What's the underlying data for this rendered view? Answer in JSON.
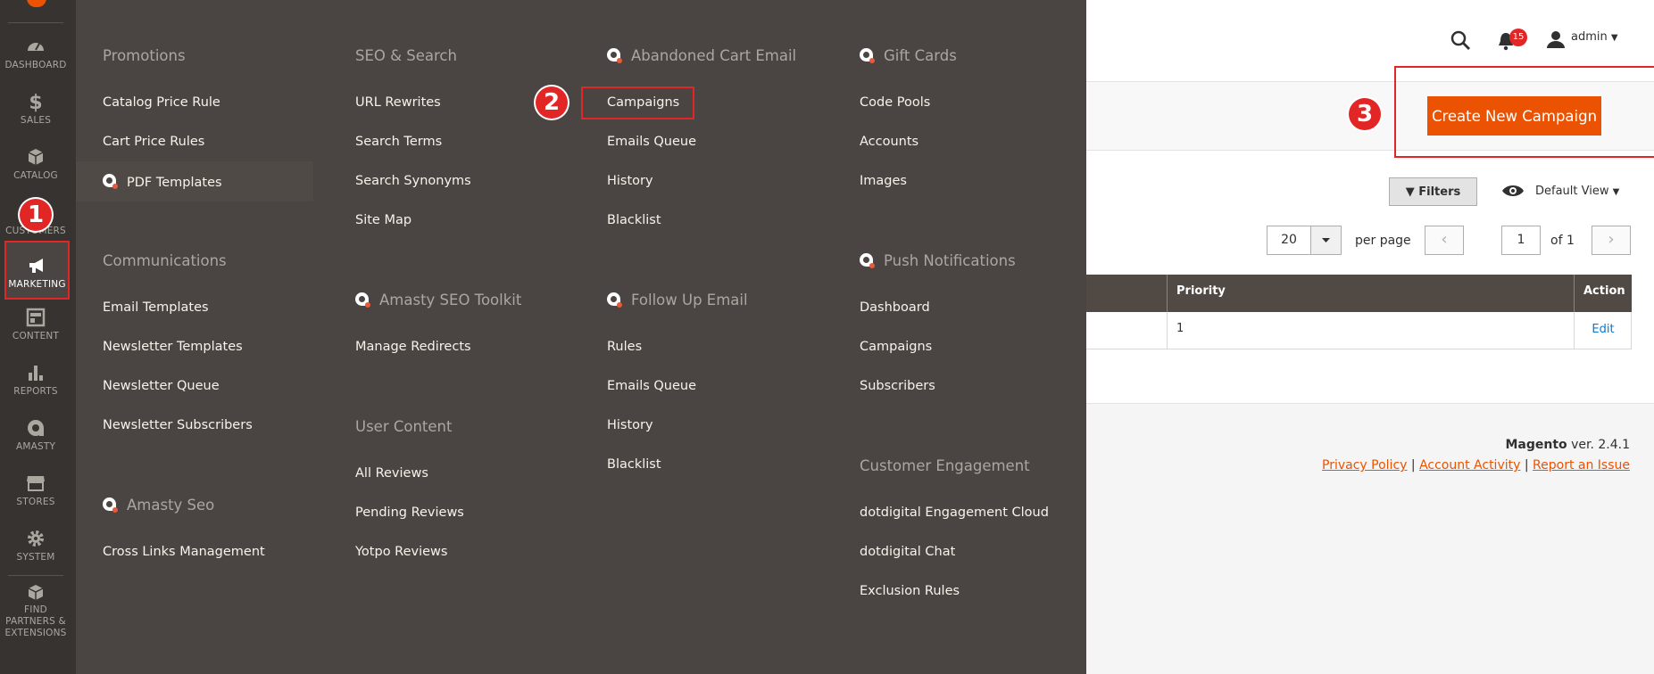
{
  "colors": {
    "sidebar": "#373330",
    "menu": "#4a4542",
    "accent": "#eb5202",
    "callout": "#e22626"
  },
  "sidebar": {
    "items": [
      {
        "label": "DASHBOARD",
        "icon": "dashboard-icon"
      },
      {
        "label": "SALES",
        "icon": "dollar-icon"
      },
      {
        "label": "CATALOG",
        "icon": "box-icon"
      },
      {
        "label": "CUSTOMERS",
        "icon": "person-icon"
      },
      {
        "label": "MARKETING",
        "icon": "megaphone-icon"
      },
      {
        "label": "CONTENT",
        "icon": "layout-icon"
      },
      {
        "label": "REPORTS",
        "icon": "bar-chart-icon"
      },
      {
        "label": "AMASTY",
        "icon": "amasty-icon"
      },
      {
        "label": "STORES",
        "icon": "store-icon"
      },
      {
        "label": "SYSTEM",
        "icon": "gear-icon"
      },
      {
        "label": "FIND PARTNERS & EXTENSIONS",
        "icon": "cubes-icon"
      }
    ]
  },
  "callouts": {
    "one": "1",
    "two": "2",
    "three": "3"
  },
  "menu": {
    "promotions": {
      "title": "Promotions",
      "items": [
        "Catalog Price Rule",
        "Cart Price Rules",
        "PDF Templates"
      ]
    },
    "communications": {
      "title": "Communications",
      "items": [
        "Email Templates",
        "Newsletter Templates",
        "Newsletter Queue",
        "Newsletter Subscribers"
      ]
    },
    "amasty_seo": {
      "title": "Amasty Seo",
      "items": [
        "Cross Links Management"
      ]
    },
    "seo_search": {
      "title": "SEO & Search",
      "items": [
        "URL Rewrites",
        "Search Terms",
        "Search Synonyms",
        "Site Map"
      ]
    },
    "amasty_seo_toolkit": {
      "title": "Amasty SEO Toolkit",
      "items": [
        "Manage Redirects"
      ]
    },
    "user_content": {
      "title": "User Content",
      "items": [
        "All Reviews",
        "Pending Reviews",
        "Yotpo Reviews"
      ]
    },
    "abandoned_cart": {
      "title": "Abandoned Cart Email",
      "items": [
        "Campaigns",
        "Emails Queue",
        "History",
        "Blacklist"
      ]
    },
    "follow_up": {
      "title": "Follow Up Email",
      "items": [
        "Rules",
        "Emails Queue",
        "History",
        "Blacklist"
      ]
    },
    "gift_cards": {
      "title": "Gift Cards",
      "items": [
        "Code Pools",
        "Accounts",
        "Images"
      ]
    },
    "push_notifications": {
      "title": "Push Notifications",
      "items": [
        "Dashboard",
        "Campaigns",
        "Subscribers"
      ]
    },
    "customer_engagement": {
      "title": "Customer Engagement",
      "items": [
        "dotdigital Engagement Cloud",
        "dotdigital Chat",
        "Exclusion Rules"
      ]
    }
  },
  "header": {
    "notifications": "15",
    "user": "admin"
  },
  "actions": {
    "create_label": "Create New Campaign"
  },
  "toolbar": {
    "filters_label": "Filters",
    "view_label": "Default View",
    "per_page_value": "20",
    "per_page_label": "per page",
    "page_value": "1",
    "page_of": "of 1"
  },
  "grid": {
    "columns": [
      "Priority",
      "Action"
    ],
    "rows": [
      {
        "priority": "1",
        "action": "Edit"
      }
    ]
  },
  "footer": {
    "brand": "Magento",
    "version": " ver. 2.4.1",
    "links": [
      "Privacy Policy",
      "Account Activity",
      "Report an Issue"
    ],
    "separator": " | "
  }
}
